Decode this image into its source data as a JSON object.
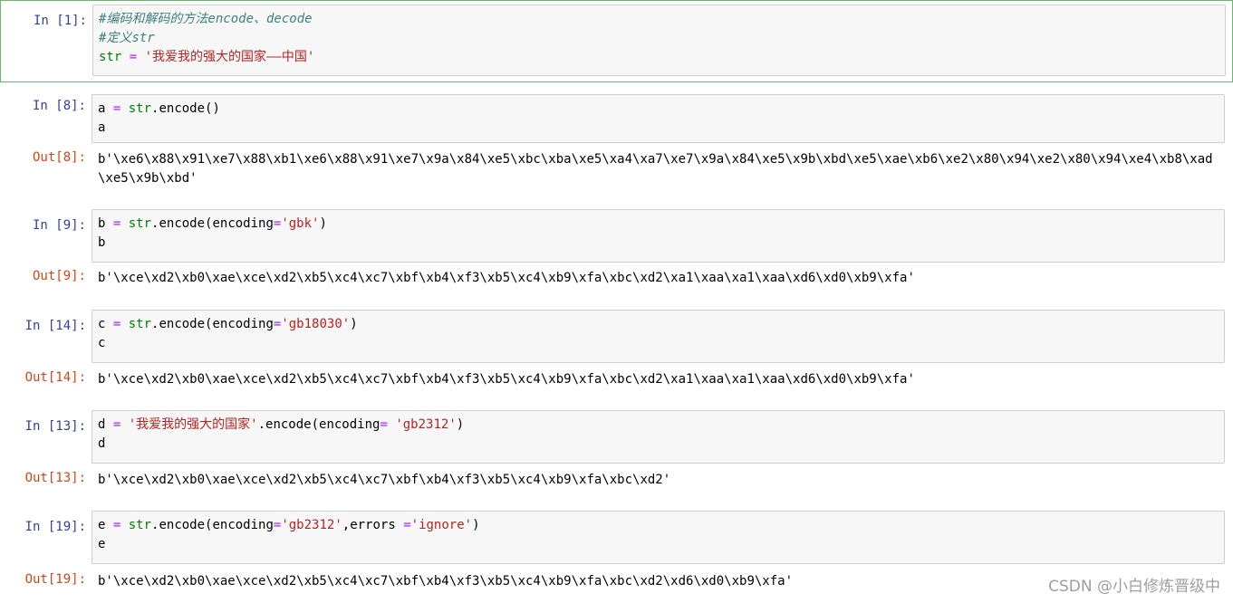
{
  "cells": [
    {
      "in_prompt": "In  [1]:",
      "lines": [
        [
          {
            "t": "comment",
            "v": "#编码和解码的方法encode、decode"
          }
        ],
        [
          {
            "t": "comment",
            "v": "#定义str"
          }
        ],
        [
          {
            "t": "builtin",
            "v": "str"
          },
          {
            "t": "plain",
            "v": " "
          },
          {
            "t": "op",
            "v": "="
          },
          {
            "t": "plain",
            "v": " "
          },
          {
            "t": "str",
            "v": "'我爱我的强大的国家——中国'"
          }
        ]
      ]
    },
    {
      "in_prompt": "In  [8]:",
      "lines": [
        [
          {
            "t": "plain",
            "v": "a "
          },
          {
            "t": "op",
            "v": "="
          },
          {
            "t": "plain",
            "v": " "
          },
          {
            "t": "builtin",
            "v": "str"
          },
          {
            "t": "plain",
            "v": ".encode()"
          }
        ],
        [
          {
            "t": "plain",
            "v": "a"
          }
        ]
      ],
      "out_prompt": "Out[8]:",
      "output": "b'\\xe6\\x88\\x91\\xe7\\x88\\xb1\\xe6\\x88\\x91\\xe7\\x9a\\x84\\xe5\\xbc\\xba\\xe5\\xa4\\xa7\\xe7\\x9a\\x84\\xe5\\x9b\\xbd\\xe5\\xae\\xb6\\xe2\\x80\\x94\\xe2\\x80\\x94\\xe4\\xb8\\xad\\xe5\\x9b\\xbd'"
    },
    {
      "in_prompt": "In  [9]:",
      "lines": [
        [
          {
            "t": "plain",
            "v": "b "
          },
          {
            "t": "op",
            "v": "="
          },
          {
            "t": "plain",
            "v": " "
          },
          {
            "t": "builtin",
            "v": "str"
          },
          {
            "t": "plain",
            "v": ".encode(encoding"
          },
          {
            "t": "op",
            "v": "="
          },
          {
            "t": "str",
            "v": "'gbk'"
          },
          {
            "t": "plain",
            "v": ")"
          }
        ],
        [
          {
            "t": "plain",
            "v": "b"
          }
        ]
      ],
      "out_prompt": "Out[9]:",
      "output": "b'\\xce\\xd2\\xb0\\xae\\xce\\xd2\\xb5\\xc4\\xc7\\xbf\\xb4\\xf3\\xb5\\xc4\\xb9\\xfa\\xbc\\xd2\\xa1\\xaa\\xa1\\xaa\\xd6\\xd0\\xb9\\xfa'"
    },
    {
      "in_prompt": "In  [14]:",
      "lines": [
        [
          {
            "t": "plain",
            "v": "c "
          },
          {
            "t": "op",
            "v": "="
          },
          {
            "t": "plain",
            "v": " "
          },
          {
            "t": "builtin",
            "v": "str"
          },
          {
            "t": "plain",
            "v": ".encode(encoding"
          },
          {
            "t": "op",
            "v": "="
          },
          {
            "t": "str",
            "v": "'gb18030'"
          },
          {
            "t": "plain",
            "v": ")"
          }
        ],
        [
          {
            "t": "plain",
            "v": "c"
          }
        ]
      ],
      "out_prompt": "Out[14]:",
      "output": "b'\\xce\\xd2\\xb0\\xae\\xce\\xd2\\xb5\\xc4\\xc7\\xbf\\xb4\\xf3\\xb5\\xc4\\xb9\\xfa\\xbc\\xd2\\xa1\\xaa\\xa1\\xaa\\xd6\\xd0\\xb9\\xfa'"
    },
    {
      "in_prompt": "In  [13]:",
      "lines": [
        [
          {
            "t": "plain",
            "v": "d "
          },
          {
            "t": "op",
            "v": "="
          },
          {
            "t": "plain",
            "v": " "
          },
          {
            "t": "str",
            "v": "'我爱我的强大的国家'"
          },
          {
            "t": "plain",
            "v": ".encode(encoding"
          },
          {
            "t": "op",
            "v": "="
          },
          {
            "t": "plain",
            "v": " "
          },
          {
            "t": "str",
            "v": "'gb2312'"
          },
          {
            "t": "plain",
            "v": ")"
          }
        ],
        [
          {
            "t": "plain",
            "v": "d"
          }
        ]
      ],
      "out_prompt": "Out[13]:",
      "output": "b'\\xce\\xd2\\xb0\\xae\\xce\\xd2\\xb5\\xc4\\xc7\\xbf\\xb4\\xf3\\xb5\\xc4\\xb9\\xfa\\xbc\\xd2'"
    },
    {
      "in_prompt": "In  [19]:",
      "lines": [
        [
          {
            "t": "plain",
            "v": "e "
          },
          {
            "t": "op",
            "v": "="
          },
          {
            "t": "plain",
            "v": " "
          },
          {
            "t": "builtin",
            "v": "str"
          },
          {
            "t": "plain",
            "v": ".encode(encoding"
          },
          {
            "t": "op",
            "v": "="
          },
          {
            "t": "str",
            "v": "'gb2312'"
          },
          {
            "t": "plain",
            "v": ",errors "
          },
          {
            "t": "op",
            "v": "="
          },
          {
            "t": "str",
            "v": "'ignore'"
          },
          {
            "t": "plain",
            "v": ")"
          }
        ],
        [
          {
            "t": "plain",
            "v": "e"
          }
        ]
      ],
      "out_prompt": "Out[19]:",
      "output": "b'\\xce\\xd2\\xb0\\xae\\xce\\xd2\\xb5\\xc4\\xc7\\xbf\\xb4\\xf3\\xb5\\xc4\\xb9\\xfa\\xbc\\xd2\\xd6\\xd0\\xb9\\xfa'"
    }
  ],
  "watermark": "CSDN @小白修炼晋级中"
}
